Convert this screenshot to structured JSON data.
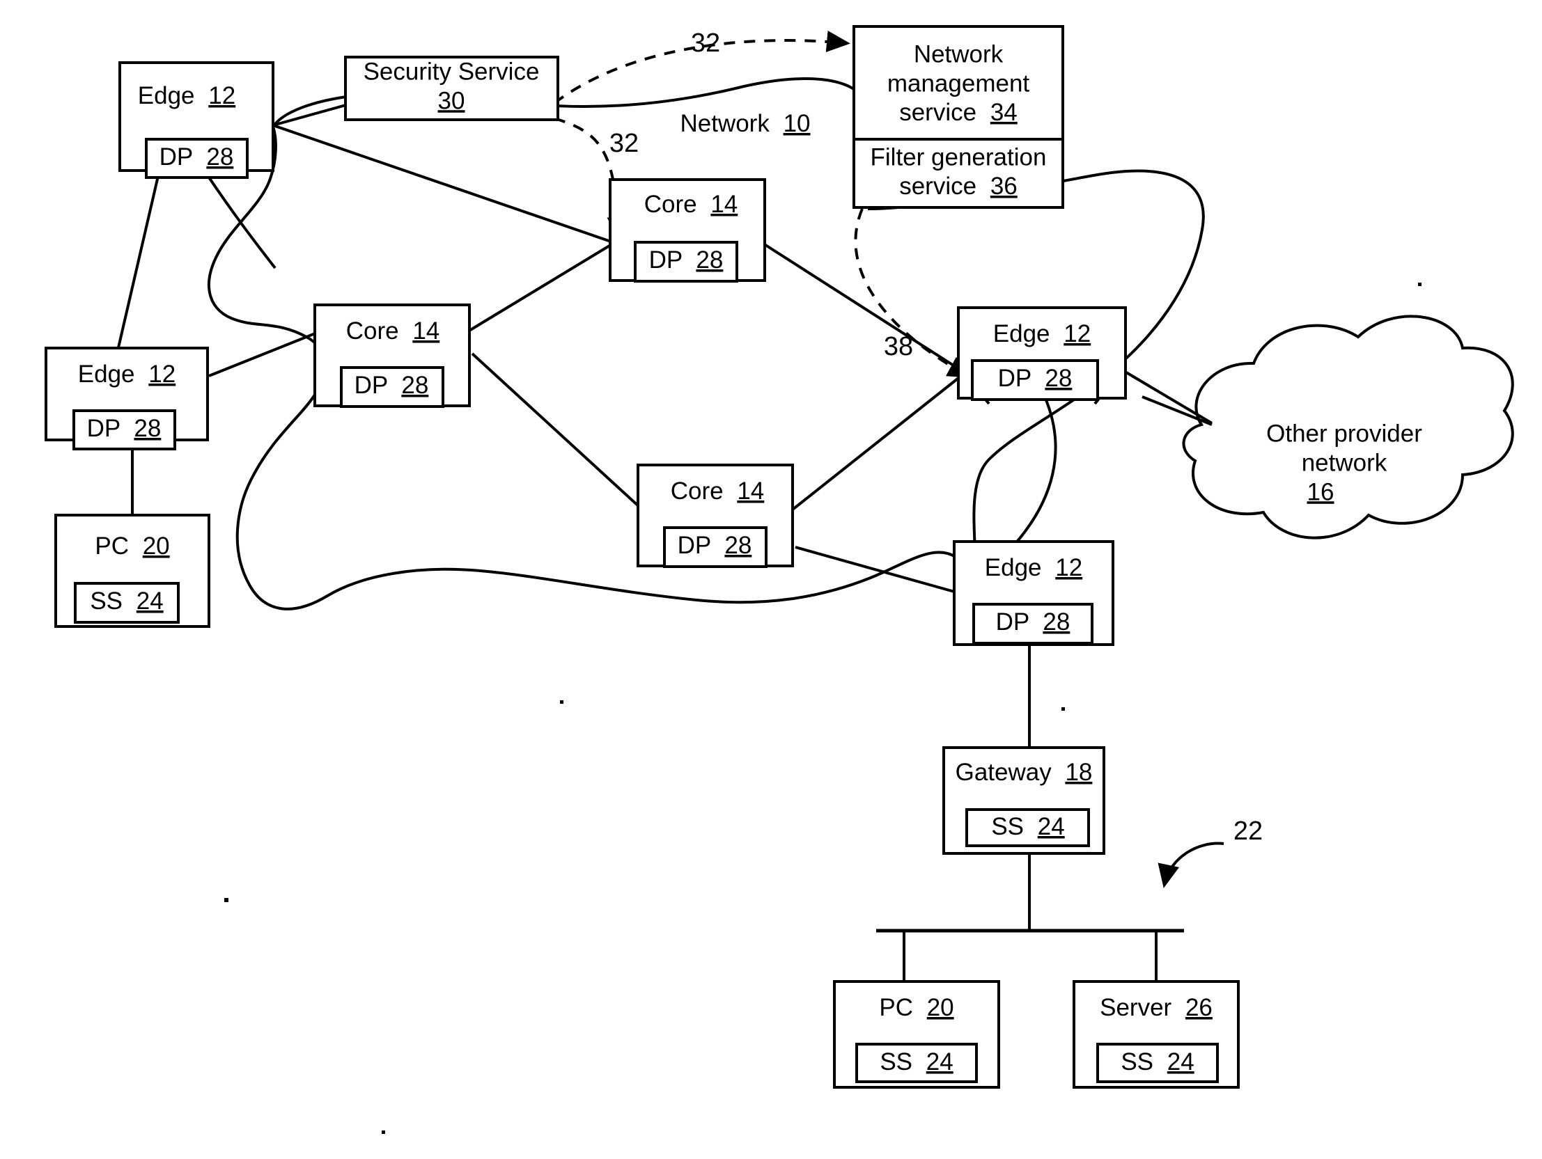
{
  "figure": {
    "type": "network-architecture-patent-diagram",
    "background_color": "#ffffff",
    "line_color": "#000000"
  },
  "network_cloud": {
    "label": "Network",
    "ref": "10"
  },
  "nodes": {
    "edge_top_left": {
      "title": "Edge",
      "ref": "12",
      "inner_title": "DP",
      "inner_ref": "28"
    },
    "edge_mid_left": {
      "title": "Edge",
      "ref": "12",
      "inner_title": "DP",
      "inner_ref": "28"
    },
    "edge_right": {
      "title": "Edge",
      "ref": "12",
      "inner_title": "DP",
      "inner_ref": "28"
    },
    "edge_bottom": {
      "title": "Edge",
      "ref": "12",
      "inner_title": "DP",
      "inner_ref": "28"
    },
    "core_top": {
      "title": "Core",
      "ref": "14",
      "inner_title": "DP",
      "inner_ref": "28"
    },
    "core_left": {
      "title": "Core",
      "ref": "14",
      "inner_title": "DP",
      "inner_ref": "28"
    },
    "core_bottom": {
      "title": "Core",
      "ref": "14",
      "inner_title": "DP",
      "inner_ref": "28"
    },
    "pc_left": {
      "title": "PC",
      "ref": "20",
      "inner_title": "SS",
      "inner_ref": "24"
    },
    "pc_bottom": {
      "title": "PC",
      "ref": "20",
      "inner_title": "SS",
      "inner_ref": "24"
    },
    "server_bottom": {
      "title": "Server",
      "ref": "26",
      "inner_title": "SS",
      "inner_ref": "24"
    },
    "gateway": {
      "title": "Gateway",
      "ref": "18",
      "inner_title": "SS",
      "inner_ref": "24"
    },
    "security_service": {
      "title": "Security Service",
      "ref": "30"
    },
    "network_management_service": {
      "title_line1": "Network",
      "title_line2": "management",
      "title_line3": "service",
      "ref": "34"
    },
    "filter_generation_service": {
      "title_line1": "Filter generation",
      "title_line2": "service",
      "ref": "36"
    },
    "other_provider_network": {
      "title_line1": "Other provider",
      "title_line2": "network",
      "ref": "16"
    }
  },
  "callouts": {
    "flow_32_top": "32",
    "flow_32_lower": "32",
    "flow_38": "38",
    "lan_22": "22"
  }
}
